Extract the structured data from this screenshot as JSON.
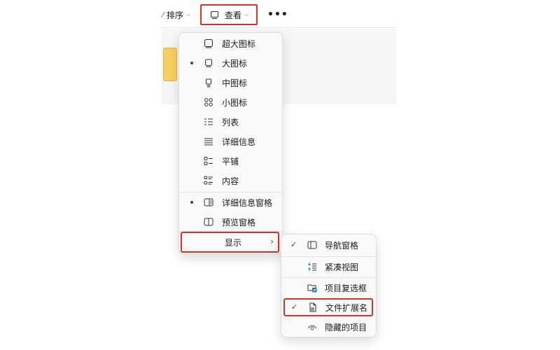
{
  "toolbar": {
    "sort_label": "排序",
    "view_label": "查看",
    "more_label": "•••"
  },
  "view_menu": {
    "items": [
      {
        "label": "超大图标",
        "icon": "extra-large-icons-icon",
        "selected": false
      },
      {
        "label": "大图标",
        "icon": "large-icons-icon",
        "selected": true
      },
      {
        "label": "中图标",
        "icon": "medium-icons-icon",
        "selected": false
      },
      {
        "label": "小图标",
        "icon": "small-icons-icon",
        "selected": false
      },
      {
        "label": "列表",
        "icon": "list-icon",
        "selected": false
      },
      {
        "label": "详细信息",
        "icon": "details-icon",
        "selected": false
      },
      {
        "label": "平铺",
        "icon": "tiles-icon",
        "selected": false
      },
      {
        "label": "内容",
        "icon": "content-icon",
        "selected": false
      }
    ],
    "pane_items": [
      {
        "label": "详细信息窗格",
        "icon": "details-pane-icon",
        "selected": true
      },
      {
        "label": "预览窗格",
        "icon": "preview-pane-icon",
        "selected": false
      }
    ],
    "show_label": "显示",
    "show_arrow": "›"
  },
  "show_menu": {
    "items": [
      {
        "label": "导航窗格",
        "icon": "navigation-pane-icon",
        "checked": true
      },
      {
        "label": "紧凑视图",
        "icon": "compact-view-icon",
        "checked": false
      },
      {
        "label": "项目复选框",
        "icon": "item-checkboxes-icon",
        "checked": false
      },
      {
        "label": "文件扩展名",
        "icon": "file-extension-icon",
        "checked": true
      },
      {
        "label": "隐藏的项目",
        "icon": "hidden-items-icon",
        "checked": false
      }
    ],
    "check_glyph": "✓"
  },
  "colors": {
    "highlight_border": "#d93025",
    "menu_bg": "#f9f9f9",
    "accent_blue": "#1a73c9",
    "folder_yellow": "#f6cf62"
  }
}
